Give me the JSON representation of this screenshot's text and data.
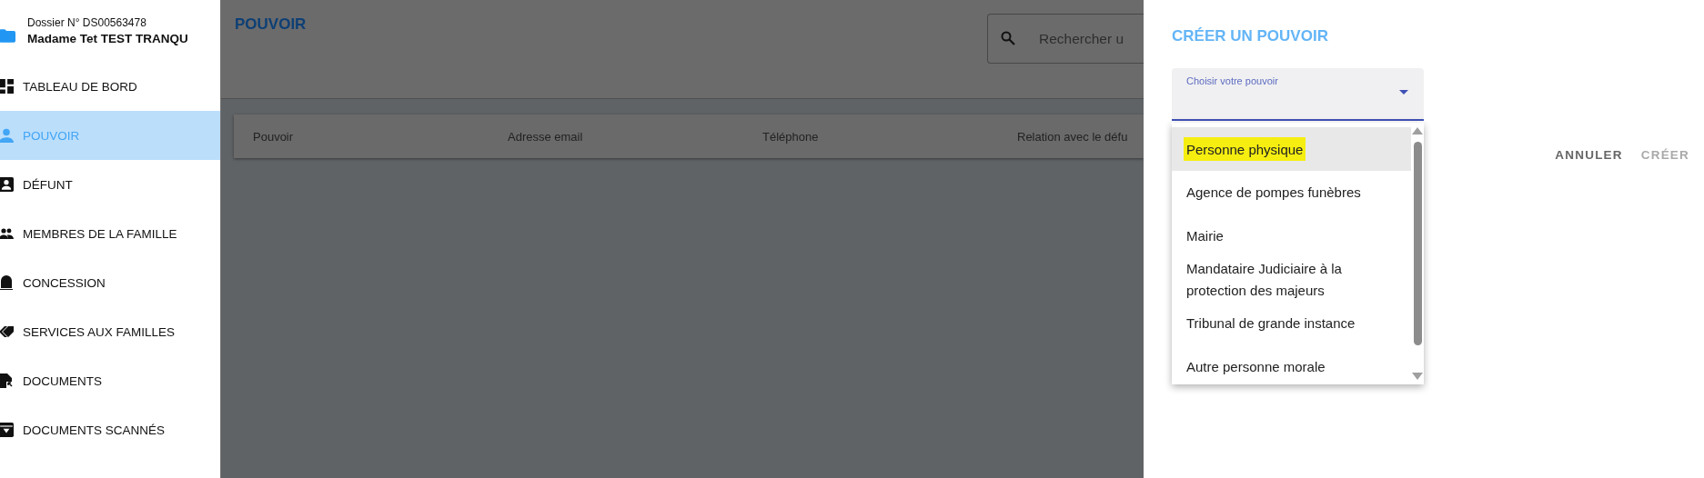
{
  "sidebar": {
    "header": {
      "file_number": "Dossier N° DS00563478",
      "name": "Madame Tet TEST TRANQU"
    },
    "items": [
      {
        "label": "TABLEAU DE BORD",
        "selected": false
      },
      {
        "label": "POUVOIR",
        "selected": true
      },
      {
        "label": "DÉFUNT",
        "selected": false
      },
      {
        "label": "MEMBRES DE LA FAMILLE",
        "selected": false
      },
      {
        "label": "CONCESSION",
        "selected": false
      },
      {
        "label": "SERVICES AUX FAMILLES",
        "selected": false
      },
      {
        "label": "DOCUMENTS",
        "selected": false
      },
      {
        "label": "DOCUMENTS SCANNÉS",
        "selected": false
      }
    ]
  },
  "main": {
    "title": "POUVOIR",
    "search": {
      "placeholder": "Rechercher u"
    },
    "table": {
      "columns": [
        "Pouvoir",
        "Adresse email",
        "Téléphone",
        "Relation avec le défu"
      ]
    }
  },
  "dialog": {
    "title": "CRÉER UN POUVOIR",
    "select": {
      "label": "Choisir votre pouvoir"
    },
    "options": [
      {
        "label": "Personne physique",
        "selected": true,
        "highlighted": true
      },
      {
        "label": "Agence de pompes funèbres",
        "selected": false,
        "highlighted": false
      },
      {
        "label": "Mairie",
        "selected": false,
        "highlighted": false
      },
      {
        "label": "Mandataire Judiciaire à la protection des majeurs",
        "selected": false,
        "highlighted": false
      },
      {
        "label": "Tribunal de grande instance",
        "selected": false,
        "highlighted": false
      },
      {
        "label": "Autre personne morale",
        "selected": false,
        "highlighted": false
      }
    ],
    "buttons": [
      {
        "label": "ANNULER",
        "disabled": false
      },
      {
        "label": "CRÉER",
        "disabled": true
      }
    ]
  }
}
